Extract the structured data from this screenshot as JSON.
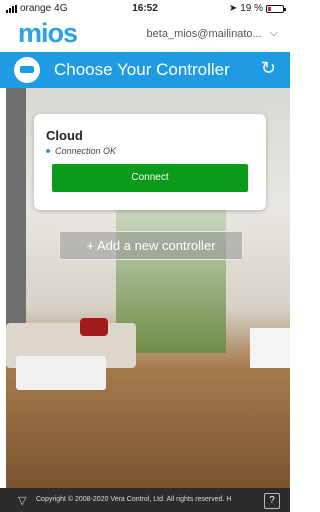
{
  "status_bar": {
    "carrier": "orange",
    "network": "4G",
    "time": "16:52",
    "battery_percent": "19 %",
    "battery_level": 0.19
  },
  "header": {
    "logo": "mios",
    "account_email": "beta_mios@mailinato...",
    "account_chevron": "⌵"
  },
  "title_bar": {
    "title": "Choose Your Controller",
    "refresh_icon": "↻"
  },
  "controller_card": {
    "name": "Cloud",
    "status": "Connection OK",
    "connect_label": "Connect"
  },
  "add_controller": {
    "label": "+ Add a new controller"
  },
  "footer": {
    "copyright": "Copyright © 2008-2020 Vera Control, Ltd. All rights reserved. H",
    "help_label": "?"
  },
  "colors": {
    "accent": "#1e9be3",
    "connect": "#0c9a1a",
    "battery_low": "#e02020"
  }
}
